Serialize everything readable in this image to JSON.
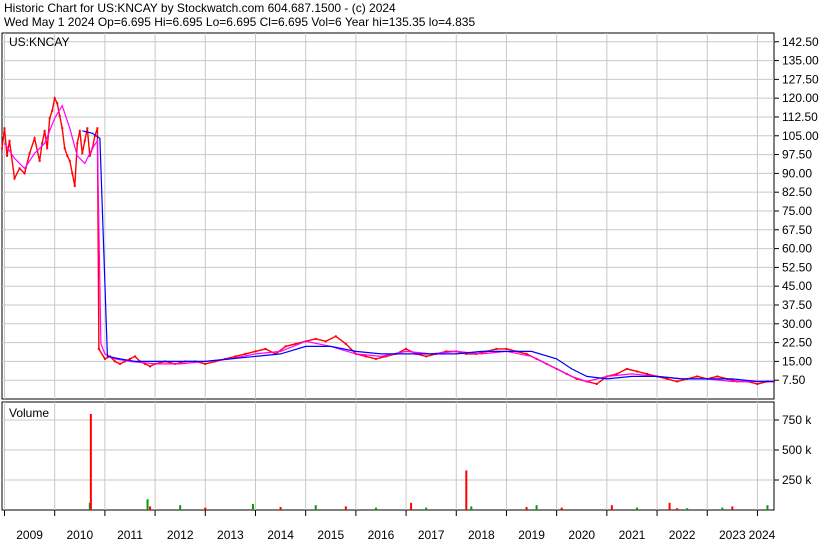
{
  "header": {
    "line1": "Historic Chart for US:KNCAY by Stockwatch.com 604.687.1500 - (c) 2024",
    "line2": "Wed May  1 2024   Op=6.695  Hi=6.695  Lo=6.695  Cl=6.695  Vol=6  Year hi=135.35  lo=4.835"
  },
  "chart_data": [
    {
      "type": "line",
      "title": "US:KNCAY",
      "ylim": [
        0,
        146
      ],
      "y_ticks": [
        "7.50",
        "15.00",
        "22.50",
        "30.00",
        "37.50",
        "45.00",
        "52.50",
        "60.00",
        "67.50",
        "75.00",
        "82.50",
        "90.00",
        "97.50",
        "105.00",
        "112.50",
        "120.00",
        "127.50",
        "135.00",
        "142.50"
      ],
      "x_ticks": [
        "2009",
        "2010",
        "2011",
        "2012",
        "2013",
        "2014",
        "2015",
        "2016",
        "2017",
        "2018",
        "2019",
        "2020",
        "2021",
        "2022",
        "2023",
        "2024"
      ],
      "grid": true,
      "series": [
        {
          "kind": "price",
          "color": "#ff0000",
          "x": [
            2008.95,
            2009.0,
            2009.05,
            2009.1,
            2009.2,
            2009.3,
            2009.4,
            2009.5,
            2009.6,
            2009.7,
            2009.75,
            2009.8,
            2009.85,
            2009.9,
            2009.95,
            2010.0,
            2010.05,
            2010.1,
            2010.15,
            2010.2,
            2010.25,
            2010.3,
            2010.35,
            2010.4,
            2010.45,
            2010.5,
            2010.55,
            2010.6,
            2010.65,
            2010.7,
            2010.75,
            2010.8,
            2010.85,
            2010.88,
            2011.0,
            2011.1,
            2011.2,
            2011.3,
            2011.4,
            2011.5,
            2011.6,
            2011.7,
            2011.8,
            2011.9,
            2012.0,
            2012.2,
            2012.4,
            2012.6,
            2012.8,
            2013.0,
            2013.2,
            2013.4,
            2013.6,
            2013.8,
            2014.0,
            2014.2,
            2014.4,
            2014.6,
            2014.8,
            2015.0,
            2015.2,
            2015.4,
            2015.6,
            2015.8,
            2016.0,
            2016.2,
            2016.4,
            2016.6,
            2016.8,
            2017.0,
            2017.2,
            2017.4,
            2017.6,
            2017.8,
            2018.0,
            2018.2,
            2018.4,
            2018.6,
            2018.8,
            2019.0,
            2019.2,
            2019.4,
            2019.6,
            2019.8,
            2020.0,
            2020.2,
            2020.4,
            2020.6,
            2020.8,
            2021.0,
            2021.2,
            2021.4,
            2021.6,
            2021.8,
            2022.0,
            2022.2,
            2022.4,
            2022.6,
            2022.8,
            2023.0,
            2023.2,
            2023.4,
            2023.6,
            2023.8,
            2024.0,
            2024.2,
            2024.33
          ],
          "y": [
            100,
            108,
            97,
            103,
            88,
            92,
            90,
            98,
            104,
            95,
            102,
            107,
            100,
            112,
            115,
            120,
            118,
            113,
            108,
            100,
            97,
            95,
            90,
            85,
            102,
            107,
            98,
            103,
            108,
            97,
            100,
            105,
            108,
            20,
            16,
            17,
            15,
            14,
            15,
            16,
            17,
            15,
            14,
            13,
            14,
            15,
            14,
            15,
            15,
            14,
            15,
            16,
            17,
            18,
            19,
            20,
            18,
            21,
            22,
            23,
            24,
            23,
            25,
            22,
            18,
            17,
            16,
            17,
            18,
            20,
            18,
            17,
            18,
            19,
            19,
            18,
            18,
            19,
            20,
            20,
            19,
            18,
            16,
            14,
            12,
            10,
            8,
            7,
            6,
            9,
            10,
            12,
            11,
            10,
            9,
            8,
            7,
            8,
            9,
            8,
            9,
            8,
            7,
            7,
            6,
            7,
            7
          ]
        },
        {
          "kind": "moving-average-short",
          "color": "#ff00ff",
          "x": [
            2009.0,
            2009.2,
            2009.4,
            2009.6,
            2009.8,
            2010.0,
            2010.15,
            2010.3,
            2010.45,
            2010.6,
            2010.75,
            2010.85,
            2010.92,
            2011.0,
            2011.2,
            2011.5,
            2012.0,
            2012.5,
            2013.0,
            2013.5,
            2014.0,
            2014.5,
            2015.0,
            2015.5,
            2016.0,
            2016.5,
            2017.0,
            2017.5,
            2018.0,
            2018.5,
            2019.0,
            2019.5,
            2020.0,
            2020.3,
            2020.6,
            2021.0,
            2021.5,
            2022.0,
            2022.5,
            2023.0,
            2023.5,
            2024.0,
            2024.33
          ],
          "y": [
            102,
            96,
            92,
            98,
            102,
            112,
            117,
            108,
            97,
            94,
            100,
            103,
            22,
            18,
            16,
            15,
            14,
            14,
            15,
            16,
            18,
            19,
            23,
            21,
            18,
            17,
            19,
            18,
            19,
            18,
            19,
            17,
            12,
            9,
            7,
            9,
            10,
            9,
            8,
            8,
            7,
            7,
            7
          ]
        },
        {
          "kind": "moving-average-long",
          "color": "#0000ff",
          "x": [
            2010.55,
            2010.75,
            2010.9,
            2011.05,
            2011.3,
            2011.6,
            2012.0,
            2012.5,
            2013.0,
            2013.5,
            2014.0,
            2014.5,
            2015.0,
            2015.5,
            2016.0,
            2016.5,
            2017.0,
            2017.5,
            2018.0,
            2018.5,
            2019.0,
            2019.5,
            2020.0,
            2020.3,
            2020.6,
            2021.0,
            2021.5,
            2022.0,
            2022.5,
            2023.0,
            2023.5,
            2024.0,
            2024.33
          ],
          "y": [
            107,
            106,
            104,
            17,
            16,
            15,
            15,
            15,
            15,
            16,
            17,
            18,
            21,
            21,
            19,
            18,
            18,
            18,
            18,
            19,
            19,
            19,
            16,
            12,
            9,
            8,
            9,
            9,
            8,
            8,
            8,
            7,
            7
          ]
        }
      ]
    },
    {
      "type": "bar",
      "title": "Volume",
      "ylim": [
        0,
        900
      ],
      "y_unit": "k",
      "y_ticks": [
        "250 k",
        "500 k",
        "750 k"
      ],
      "x_ticks": [
        "2009",
        "2010",
        "2011",
        "2012",
        "2013",
        "2014",
        "2015",
        "2016",
        "2017",
        "2018",
        "2019",
        "2020",
        "2021",
        "2022",
        "2023",
        "2024"
      ],
      "grid": true,
      "series": [
        {
          "kind": "volume-up",
          "color": "#00a000",
          "x": [
            2010.7,
            2011.85,
            2012.5,
            2013.95,
            2015.2,
            2016.4,
            2017.4,
            2018.3,
            2019.6,
            2021.6,
            2022.6,
            2023.3,
            2024.2
          ],
          "y": [
            60,
            90,
            40,
            50,
            40,
            20,
            20,
            30,
            40,
            20,
            15,
            20,
            40
          ]
        },
        {
          "kind": "volume-down",
          "color": "#ff0000",
          "x": [
            2010.72,
            2011.9,
            2013.0,
            2014.5,
            2015.8,
            2017.1,
            2018.2,
            2019.4,
            2020.1,
            2021.1,
            2022.25,
            2022.4,
            2023.5
          ],
          "y": [
            800,
            30,
            20,
            25,
            30,
            60,
            330,
            25,
            20,
            40,
            60,
            15,
            30
          ]
        }
      ]
    }
  ]
}
